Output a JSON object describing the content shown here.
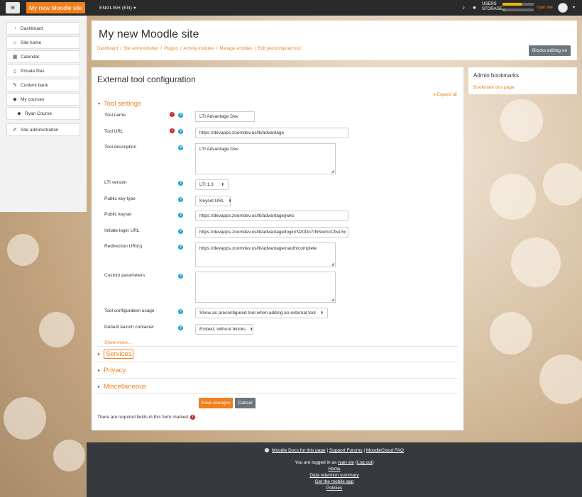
{
  "navbar": {
    "site_name": "My new Moodle site",
    "language": "ENGLISH (EN)",
    "usage_users_label": "USERS",
    "usage_storage_label": "STORAGE",
    "usage_users_fraction": 0.62,
    "usage_storage_fraction": 0.1,
    "username": "ryan xie",
    "colors": {
      "bg": "#2a2a2a",
      "brand": "#f07f1d",
      "users_bar": "#f0b400",
      "storage_bar": "#3fb950"
    }
  },
  "drawer": {
    "items": [
      {
        "label": "Dashboard",
        "icon": "dashboard-icon",
        "glyph": "◔"
      },
      {
        "label": "Site home",
        "icon": "home-icon",
        "glyph": "⌂"
      },
      {
        "label": "Calendar",
        "icon": "calendar-icon",
        "glyph": "▦"
      },
      {
        "label": "Private files",
        "icon": "file-icon",
        "glyph": "▯"
      },
      {
        "label": "Content bank",
        "icon": "brush-icon",
        "glyph": "✎"
      },
      {
        "label": "My courses",
        "icon": "graduation-cap-icon",
        "glyph": "◆"
      },
      {
        "label": "Ryan Course",
        "icon": "graduation-cap-icon",
        "glyph": "◆"
      },
      {
        "label": "Site administration",
        "icon": "wrench-icon",
        "glyph": "✐"
      }
    ]
  },
  "header": {
    "title": "My new Moodle site",
    "breadcrumb": [
      "Dashboard",
      "Site administration",
      "Plugins",
      "Activity modules",
      "Manage activities",
      "Edit preconfigured tool"
    ],
    "blocks_button": "Blocks editing on"
  },
  "form": {
    "title": "External tool configuration",
    "expand_all": "Expand all",
    "tool_settings": "Tool settings",
    "fields": {
      "tool_name": {
        "label": "Tool name",
        "value": "LTI Advantage Dev"
      },
      "tool_url": {
        "label": "Tool URL",
        "value": "https://devapps.zoomdev.us/lti/advantage"
      },
      "tool_description": {
        "label": "Tool description",
        "value": "LTI Advantage Dev"
      },
      "lti_version": {
        "label": "LTI version",
        "value": "LTI 1.3"
      },
      "public_key_type": {
        "label": "Public key type",
        "value": "Keyset URL"
      },
      "public_keyset": {
        "label": "Public keyset",
        "value": "https://devapps.zoomdev.us/lti/advantage/jwks"
      },
      "initiate_login_url": {
        "label": "Initiate login URL",
        "value": "https://devapps.zoomdev.us/lti/advantage/login/N20Dn7rNSwmcCbvL5c"
      },
      "redirection_uris": {
        "label": "Redirection URI(s)",
        "value": "https://devapps.zoomdev.us/lti/advantage/oauth/complete"
      },
      "custom_parameters": {
        "label": "Custom parameters",
        "value": ""
      },
      "tool_config_usage": {
        "label": "Tool configuration usage",
        "value": "Show as preconfigured tool when adding an external tool"
      },
      "default_launch_container": {
        "label": "Default launch container",
        "value": "Embed, without blocks"
      }
    },
    "show_more": "Show more...",
    "sections": [
      "Services",
      "Privacy",
      "Miscellaneous"
    ],
    "save_label": "Save changes",
    "cancel_label": "Cancel",
    "required_note": "There are required fields in this form marked",
    "required_note_end": "."
  },
  "side_block": {
    "title": "Admin bookmarks",
    "link": "Bookmark this page"
  },
  "footer": {
    "docs_link": "Moodle Docs for this page",
    "sep": "|",
    "forums_link": "Support Forums",
    "faq_link": "MoodleCloud FAQ",
    "logged_in_prefix": "You are logged in as",
    "logged_in_user": "ryan xie",
    "logout_open": "(",
    "logout_link": "Log out",
    "logout_close": ")",
    "home": "Home",
    "data_retention": "Data retention summary",
    "mobile_app": "Get the mobile app",
    "policies": "Policies"
  }
}
